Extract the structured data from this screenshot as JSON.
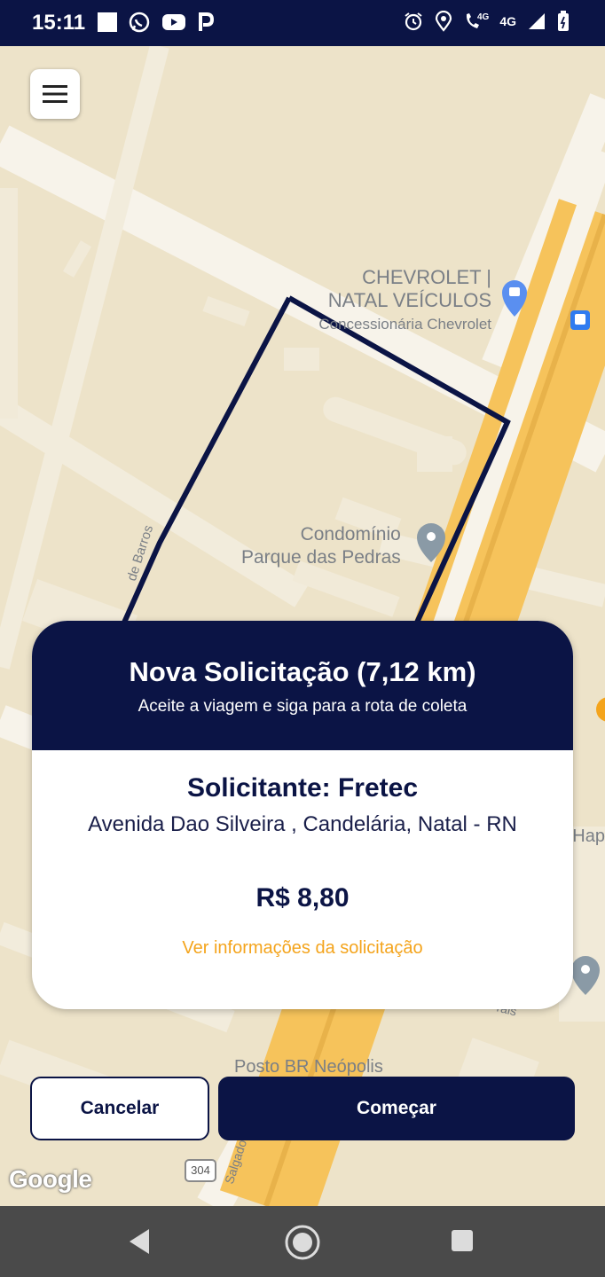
{
  "status_bar": {
    "time": "15:11",
    "network": "4G",
    "network_small": "4G",
    "left_icons": [
      "square-icon",
      "whatsapp-icon",
      "youtube-icon",
      "parking-app-icon"
    ],
    "right_icons": [
      "alarm-icon",
      "location-icon",
      "volte-call-icon",
      "signal-icon",
      "battery-icon"
    ]
  },
  "map": {
    "poi_chevrolet_line1": "CHEVROLET |",
    "poi_chevrolet_line2": "NATAL VEÍCULOS",
    "poi_chevrolet_sub": "Concessionária Chevrolet",
    "poi_condominio_line1": "Condomínio",
    "poi_condominio_line2": "Parque das Pedras",
    "poi_posto": "Posto BR Neópolis",
    "street_barros": "de Barros",
    "street_salgado": "Salgado F",
    "street_rais": "rais",
    "edge_label_hap": "Hap",
    "road_shield": "304",
    "attribution": "Google",
    "route_color": "#0b1445"
  },
  "card": {
    "title": "Nova Solicitação (7,12 km)",
    "subtitle": "Aceite a viagem e siga para a rota de coleta",
    "requester": "Solicitante: Fretec",
    "address": "Avenida Dao Silveira , Candelária, Natal - RN",
    "price": "R$ 8,80",
    "info_link": "Ver informações da solicitação"
  },
  "actions": {
    "cancel_label": "Cancelar",
    "start_label": "Começar"
  },
  "colors": {
    "primary": "#0b1445",
    "accent": "#f4a41c",
    "map_background": "#ede3c9",
    "highway": "#f6c35b"
  }
}
